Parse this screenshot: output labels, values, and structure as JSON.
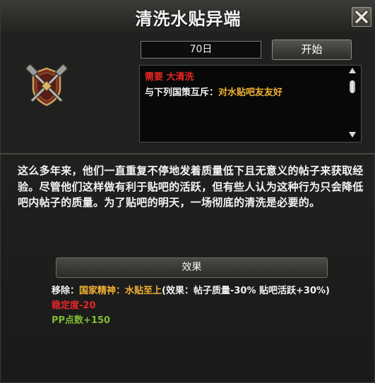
{
  "window": {
    "title": "清洗水贴异端"
  },
  "controls": {
    "days_value": "70日",
    "start_label": "开始"
  },
  "requirements": {
    "need_label": "需要",
    "need_value": "大清洗",
    "conflict_label": "与下列国策互斥：",
    "conflict_value": "对水贴吧友友好"
  },
  "description": "这么多年来，他们一直重复不停地发着质量低下且无意义的帖子来获取经验。尽管他们这样做有利于贴吧的活跃，但有些人认为这种行为只会降低吧内帖子的质量。为了贴吧的明天，一场彻底的清洗是必要的。",
  "effects": {
    "header_label": "效果",
    "remove_label": "移除：",
    "remove_value": "国家精神：水贴至上",
    "remove_detail": "(效果：帖子质量-30% 贴吧活跃+30%)",
    "stability": "稳定度-20",
    "pp": "PP点数+150"
  },
  "colors": {
    "red": "#e82626",
    "yellow": "#f2b232",
    "green": "#7fbe33",
    "panel_bg": "#1c1c1b"
  },
  "icons": {
    "close": "close-x-icon",
    "emblem": "crossed-hammers-shield-icon"
  }
}
